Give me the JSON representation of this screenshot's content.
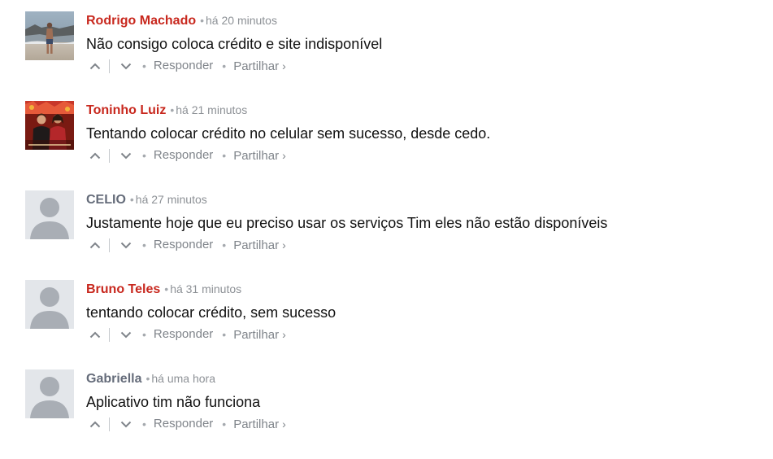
{
  "comments": [
    {
      "author": "Rodrigo Machado",
      "author_color": "#c8281e",
      "separator": "•",
      "time": "há 20 minutos",
      "text": "Não consigo coloca crédito e site indisponível",
      "avatar": "photo-beach",
      "actions": {
        "reply": "Responder",
        "share": "Partilhar",
        "share_arrow": "›",
        "dot": "•"
      }
    },
    {
      "author": "Toninho Luiz",
      "author_color": "#c8281e",
      "separator": "•",
      "time": "há 21 minutos",
      "text": "Tentando colocar crédito no celular sem sucesso, desde cedo.",
      "avatar": "photo-people",
      "actions": {
        "reply": "Responder",
        "share": "Partilhar",
        "share_arrow": "›",
        "dot": "•"
      }
    },
    {
      "author": "CELIO",
      "author_color": "#656c7a",
      "separator": "•",
      "time": "há 27 minutos",
      "text": "Justamente hoje que eu preciso usar os serviços Tim eles não estão disponíveis",
      "avatar": "default-user-icon",
      "actions": {
        "reply": "Responder",
        "share": "Partilhar",
        "share_arrow": "›",
        "dot": "•"
      }
    },
    {
      "author": "Bruno Teles",
      "author_color": "#c8281e",
      "separator": "•",
      "time": "há 31 minutos",
      "text": "tentando colocar crédito, sem sucesso",
      "avatar": "default-user-icon",
      "actions": {
        "reply": "Responder",
        "share": "Partilhar",
        "share_arrow": "›",
        "dot": "•"
      }
    },
    {
      "author": "Gabriella",
      "author_color": "#656c7a",
      "separator": "•",
      "time": "há uma hora",
      "text": "Aplicativo tim não funciona",
      "avatar": "default-user-icon",
      "actions": {
        "reply": "Responder",
        "share": "Partilhar",
        "share_arrow": "›",
        "dot": "•"
      }
    }
  ],
  "icons": {
    "upvote": "chevron-up-icon",
    "downvote": "chevron-down-icon"
  },
  "colors": {
    "author_registered": "#c8281e",
    "author_guest": "#656c7a",
    "meta": "#8d9196",
    "body": "#111111"
  }
}
